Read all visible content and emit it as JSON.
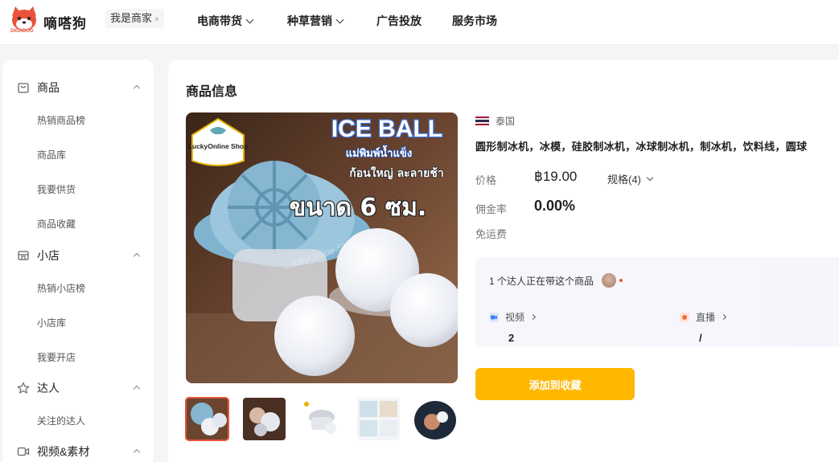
{
  "brand": {
    "name": "嘀嗒狗",
    "sub": "DIGADOG",
    "logo_icon": "shiba-dog-logo"
  },
  "merchant_chip": {
    "label": "我是商家",
    "close": "×"
  },
  "nav": [
    {
      "label": "电商带货",
      "has_dropdown": true
    },
    {
      "label": "种草营销",
      "has_dropdown": true
    },
    {
      "label": "广告投放",
      "has_dropdown": false
    },
    {
      "label": "服务市场",
      "has_dropdown": false
    }
  ],
  "sidebar": {
    "groups": [
      {
        "label": "商品",
        "icon": "shopping-bag-icon",
        "items": [
          "热销商品榜",
          "商品库",
          "我要供货",
          "商品收藏"
        ]
      },
      {
        "label": "小店",
        "icon": "store-icon",
        "items": [
          "热销小店榜",
          "小店库",
          "我要开店"
        ]
      },
      {
        "label": "达人",
        "icon": "star-icon",
        "items": [
          "关注的达人"
        ]
      },
      {
        "label": "视频&素材",
        "icon": "video-icon",
        "items": []
      }
    ]
  },
  "panel": {
    "title": "商品信息",
    "product": {
      "image_text": {
        "headline": "ICE BALL",
        "line1": "แม่พิมพ์น้ำแข็ง",
        "line2": "ก้อนใหญ่ ละลายช้า",
        "size": "ขนาด 6 ซม.",
        "shop": "LuckyOnline Shop",
        "watermark": "LuckyOnline.Shop"
      },
      "country": "泰国",
      "title": "圆形制冰机，冰模，硅胶制冰机，冰球制冰机，制冰机，饮料线，圆球",
      "price_label": "价格",
      "price": "฿19.00",
      "spec_label": "规格(4)",
      "commission_label": "佣金率",
      "commission": "0.00%",
      "shipping_label": "免运费"
    },
    "creators": {
      "count_text": "1 个达人正在带这个商品",
      "video_label": "视频",
      "video_value": "2",
      "live_label": "直播",
      "live_value": "/"
    },
    "add_button": "添加到收藏",
    "colors": {
      "accent": "#ffb700",
      "brand": "#e8533b"
    }
  }
}
